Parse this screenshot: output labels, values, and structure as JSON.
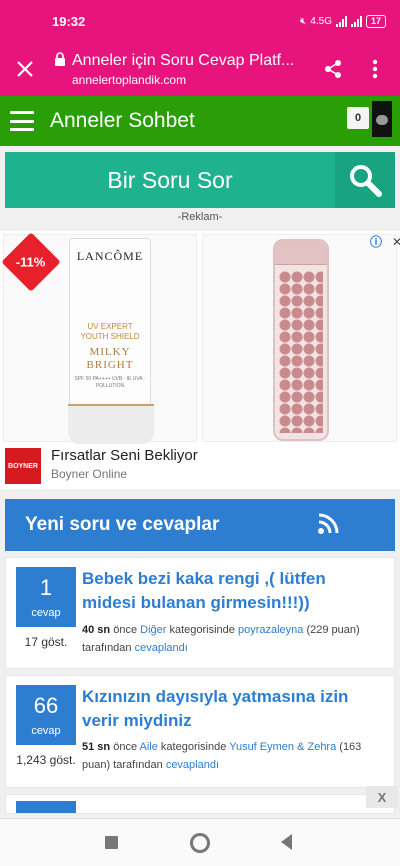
{
  "status": {
    "time": "19:32",
    "net_label_1": "4.5G",
    "battery": "17"
  },
  "tab": {
    "title": "Anneler için Soru Cevap Platf...",
    "domain": "annelertoplandik.com"
  },
  "site": {
    "brand": "Anneler Sohbet",
    "notification_count": "0"
  },
  "ask": {
    "label": "Bir Soru Sor"
  },
  "ad": {
    "reklam_label": "-Reklam-",
    "discount": "-11%",
    "product1_brand": "LANCÔME",
    "product1_line1": "UV EXPERT",
    "product1_line2": "YOUTH SHIELD",
    "product1_name1": "MILKY",
    "product1_name2": "BRIGHT",
    "product1_spec": "SPF 50 PA++++ UVB · IE UVA · POLLUTION",
    "advertiser_logo": "BOYNER",
    "headline": "Fırsatlar Seni Bekliyor",
    "source": "Boyner Online",
    "close_x": "X"
  },
  "feed": {
    "heading": "Yeni soru ve cevaplar",
    "items": [
      {
        "answers": "1",
        "answers_label": "cevap",
        "views": "17 göst.",
        "title": "Bebek bezi kaka rengi ,( lütfen midesi bulanan girmesin!!!))",
        "time": "40 sn",
        "before": "önce",
        "category": "Diğer",
        "cat_text": "kategorisinde",
        "user": "poyrazaleyna",
        "points": "(229 puan)",
        "by": "tarafından",
        "action": "cevaplandı"
      },
      {
        "answers": "66",
        "answers_label": "cevap",
        "views": "1,243 göst.",
        "title": "Kızınızın dayısıyla yatmasına izin verir miydiniz",
        "time": "51 sn",
        "before": "önce",
        "category": "Aile",
        "cat_text": "kategorisinde",
        "user": "Yusuf Eymen & Zehra",
        "points": "(163 puan)",
        "by": "tarafından",
        "action": "cevaplandı"
      }
    ]
  },
  "colors": {
    "chrome_pink": "#e8147d",
    "header_green": "#2a9e06",
    "ask_teal": "#1eb28f",
    "feed_blue": "#2d7ed1"
  },
  "icons": [
    "close-icon",
    "lock-icon",
    "share-icon",
    "more-vert-icon",
    "menu-icon",
    "search-icon",
    "rss-icon",
    "adchoices-icon"
  ]
}
